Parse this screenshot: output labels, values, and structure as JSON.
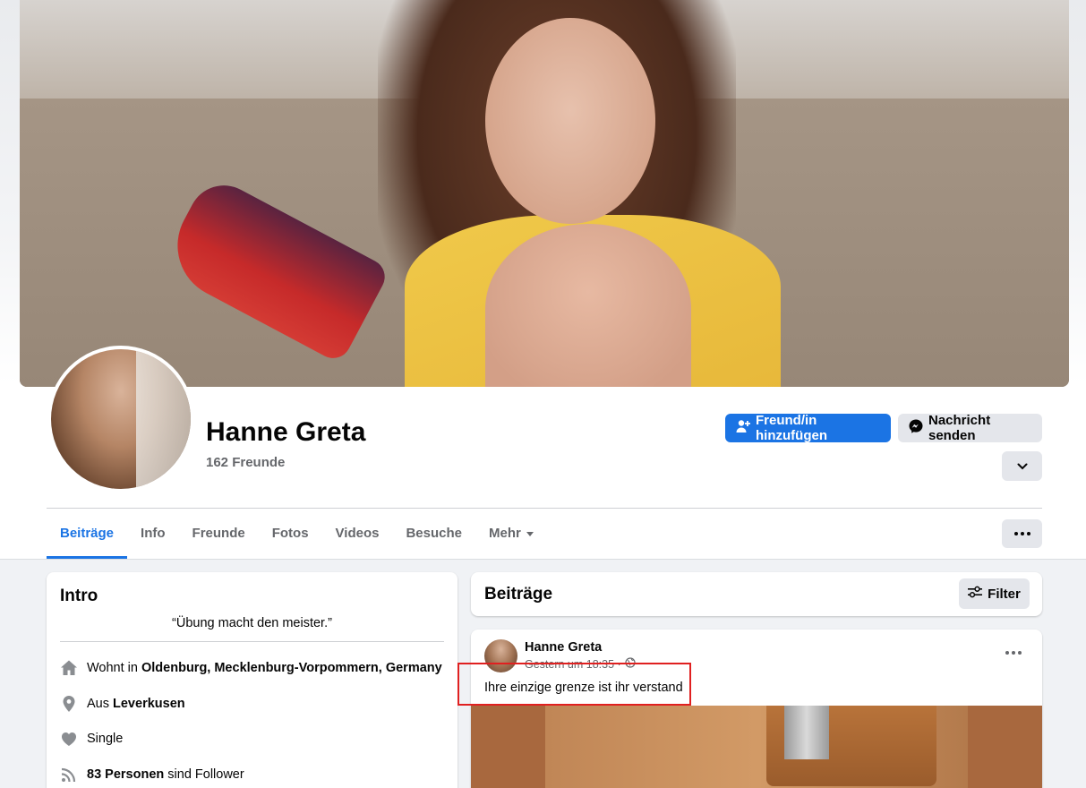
{
  "profile": {
    "name": "Hanne Greta",
    "friends_count": "162 Freunde"
  },
  "actions": {
    "add_friend": "Freund/in hinzufügen",
    "send_message": "Nachricht senden"
  },
  "tabs": [
    {
      "label": "Beiträge",
      "active": true
    },
    {
      "label": "Info"
    },
    {
      "label": "Freunde"
    },
    {
      "label": "Fotos"
    },
    {
      "label": "Videos"
    },
    {
      "label": "Besuche"
    },
    {
      "label": "Mehr"
    }
  ],
  "intro": {
    "title": "Intro",
    "bio": "“Übung macht den meister.”",
    "lives_prefix": "Wohnt in ",
    "lives_value": "Oldenburg, Mecklenburg-Vorpommern, Germany",
    "from_prefix": "Aus ",
    "from_value": "Leverkusen",
    "relationship": "Single",
    "followers_value": "83 Personen",
    "followers_suffix": " sind Follower"
  },
  "posts": {
    "title": "Beiträge",
    "filter_label": "Filter",
    "items": [
      {
        "author": "Hanne Greta",
        "time": "Gestern um 18:35 ·",
        "text": "Ihre einzige grenze ist ihr verstand"
      }
    ]
  },
  "colors": {
    "brand": "#1b74e4",
    "highlight": "#e02020"
  }
}
